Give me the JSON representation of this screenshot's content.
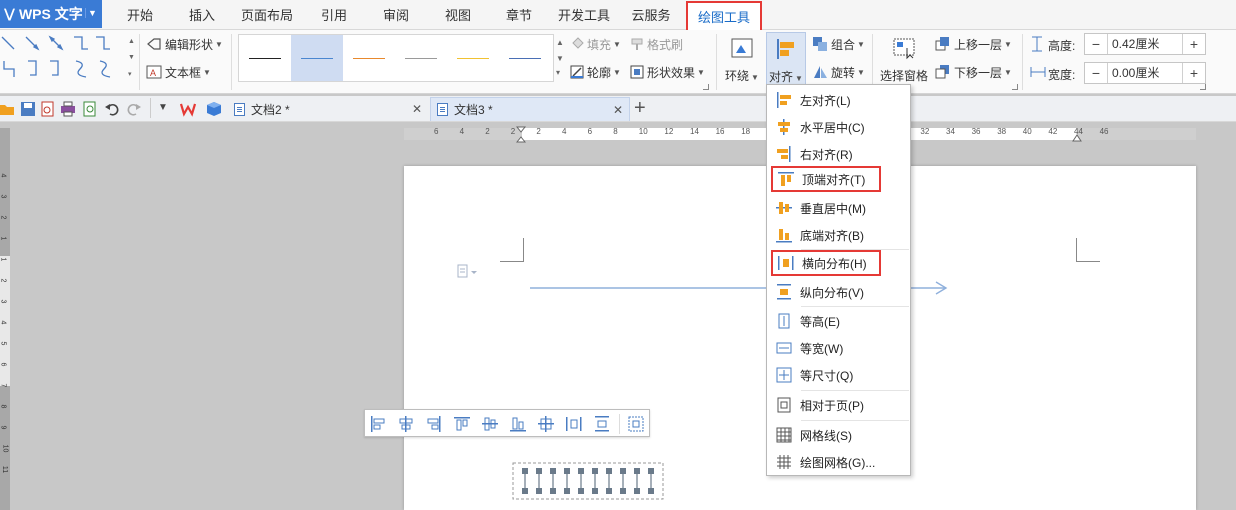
{
  "app": {
    "logo": "WPS 文字"
  },
  "menu_tabs": [
    "开始",
    "插入",
    "页面布局",
    "引用",
    "审阅",
    "视图",
    "章节",
    "开发工具",
    "云服务",
    "绘图工具"
  ],
  "ribbon": {
    "edit_shape": "编辑形状",
    "text_box": "文本框",
    "fill": "填充",
    "format_painter": "格式刷",
    "outline": "轮廓",
    "shape_effect": "形状效果",
    "wrap": "环绕",
    "align": "对齐",
    "group": "组合",
    "rotate": "旋转",
    "selection_pane": "选择窗格",
    "bring_forward": "上移一层",
    "send_backward": "下移一层",
    "height_label": "高度:",
    "height_value": "0.42厘米",
    "width_label": "宽度:",
    "width_value": "0.00厘米",
    "line_colors": [
      "#222222",
      "#4a86d0",
      "#e8892d",
      "#9a9a9a",
      "#f1c232",
      "#4a6fb5"
    ]
  },
  "doc_tabs": [
    {
      "title": "文档2 *"
    },
    {
      "title": "文档3 *"
    }
  ],
  "ruler_numbers": [
    "6",
    "4",
    "2",
    "2",
    "2",
    "4",
    "6",
    "8",
    "10",
    "12",
    "14",
    "16",
    "18",
    "20",
    "22",
    "24",
    "26",
    "28",
    "30",
    "32",
    "34",
    "36",
    "38",
    "40",
    "42",
    "44",
    "46"
  ],
  "vruler_numbers": [
    "4",
    "3",
    "2",
    "1",
    "1",
    "2",
    "3",
    "4",
    "5",
    "6",
    "7",
    "8",
    "9",
    "10",
    "11"
  ],
  "align_menu": {
    "items": [
      {
        "label": "左对齐(L)",
        "icon": "align-left-icon"
      },
      {
        "label": "水平居中(C)",
        "icon": "align-center-icon"
      },
      {
        "label": "右对齐(R)",
        "icon": "align-right-icon"
      },
      {
        "label": "顶端对齐(T)",
        "icon": "align-top-icon"
      },
      {
        "label": "垂直居中(M)",
        "icon": "align-middle-icon"
      },
      {
        "label": "底端对齐(B)",
        "icon": "align-bottom-icon"
      },
      {
        "label": "横向分布(H)",
        "icon": "distribute-horizontal-icon"
      },
      {
        "label": "纵向分布(V)",
        "icon": "distribute-vertical-icon"
      },
      {
        "label": "等高(E)",
        "icon": "same-height-icon"
      },
      {
        "label": "等宽(W)",
        "icon": "same-width-icon"
      },
      {
        "label": "等尺寸(Q)",
        "icon": "same-size-icon"
      },
      {
        "label": "相对于页(P)",
        "icon": "relative-to-page-icon"
      },
      {
        "label": "网格线(S)",
        "icon": "gridlines-icon"
      },
      {
        "label": "绘图网格(G)...",
        "icon": "drawing-grid-icon"
      }
    ]
  },
  "colors": {
    "accent": "#3a7bd5",
    "highlight": "#e53935",
    "icon_blue": "#4a7cc2",
    "icon_orange": "#f0a020"
  }
}
